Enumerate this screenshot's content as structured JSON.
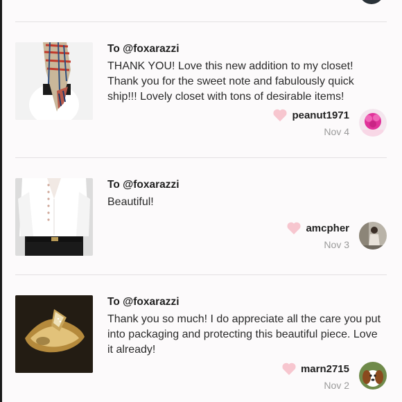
{
  "notes": [
    {
      "to": "To @foxarazzi",
      "message": "THANK YOU! Love this new addition to my closet! Thank you for the sweet note and fabulously quick ship!!! Lovely closet with tons of desirable items!",
      "username": "peanut1971",
      "date": "Nov 4",
      "thumb_icon": "plaid-scarf-photo",
      "avatar_icon": "pink-flower-avatar"
    },
    {
      "to": "To @foxarazzi",
      "message": "Beautiful!",
      "username": "amcpher",
      "date": "Nov 3",
      "thumb_icon": "white-blouse-photo",
      "avatar_icon": "person-avatar"
    },
    {
      "to": "To @foxarazzi",
      "message": "Thank you so much! I do appreciate all the care you put into packaging and protecting this beautiful piece. Love it already!",
      "username": "marn2715",
      "date": "Nov 2",
      "thumb_icon": "gold-cuff-photo",
      "avatar_icon": "dog-avatar"
    }
  ],
  "colors": {
    "heart": "#f7c6cf",
    "divider": "#e3e0e2",
    "date_text": "#9a9a9a"
  }
}
